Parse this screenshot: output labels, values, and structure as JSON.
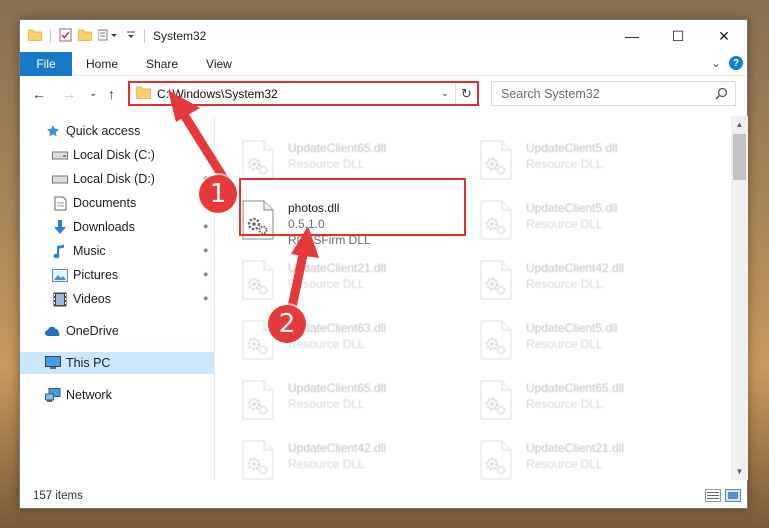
{
  "window": {
    "title": "System32",
    "controls": {
      "minimize": "—",
      "maximize": "☐",
      "close": "✕"
    }
  },
  "ribbon": {
    "tabs": [
      "File",
      "Home",
      "Share",
      "View"
    ],
    "collapse_glyph": "⌄",
    "help_glyph": "?"
  },
  "address": {
    "path": "C:\\Windows\\System32",
    "dropdown_glyph": "⌄",
    "refresh_glyph": "↻"
  },
  "nav_buttons": {
    "back": "←",
    "forward": "→",
    "recent": "⌄",
    "up": "↑"
  },
  "search": {
    "placeholder": "Search System32"
  },
  "sidebar": {
    "items": [
      {
        "label": "Quick access",
        "icon": "star-icon"
      },
      {
        "label": "Local Disk (C:)",
        "icon": "drive-icon"
      },
      {
        "label": "Local Disk (D:)",
        "icon": "drive-icon"
      },
      {
        "label": "Documents",
        "icon": "documents-icon"
      },
      {
        "label": "Downloads",
        "icon": "download-icon"
      },
      {
        "label": "Music",
        "icon": "music-icon"
      },
      {
        "label": "Pictures",
        "icon": "pictures-icon"
      },
      {
        "label": "Videos",
        "icon": "videos-icon"
      },
      {
        "label": "OneDrive",
        "icon": "cloud-icon"
      },
      {
        "label": "This PC",
        "icon": "computer-icon"
      },
      {
        "label": "Network",
        "icon": "network-icon"
      }
    ],
    "pin_glyph": "📌"
  },
  "files": {
    "left_column": [
      {
        "name": "UpdateClient65.dll",
        "sub": "Resource DLL"
      },
      {
        "name": "photos.dll",
        "version": "0.5.1.0",
        "sub": "RGTSFirm DLL"
      },
      {
        "name": "UpdateClient21.dll",
        "sub": "Resource DLL"
      },
      {
        "name": "UpdateClient63.dll",
        "sub": "Resource DLL"
      },
      {
        "name": "UpdateClient65.dll",
        "sub": "Resource DLL"
      },
      {
        "name": "UpdateClient42.dll",
        "sub": "Resource DLL"
      }
    ],
    "right_column": [
      {
        "name": "UpdateClient5.dll",
        "sub": "Resource DLL"
      },
      {
        "name": "UpdateClient5.dll",
        "sub": "Resource DLL"
      },
      {
        "name": "UpdateClient42.dll",
        "sub": "Resource DLL"
      },
      {
        "name": "UpdateClient5.dll",
        "sub": "Resource DLL"
      },
      {
        "name": "UpdateClient65.dll",
        "sub": "Resource DLL"
      },
      {
        "name": "UpdateClient21.dll",
        "sub": "Resource DLL"
      }
    ]
  },
  "status": {
    "item_count": "157 items"
  },
  "annotations": {
    "step1": "1",
    "step2": "2"
  },
  "colors": {
    "accent": "#1979ca",
    "annotation_red": "#e5393a",
    "selected_bg": "#cce8ff"
  }
}
